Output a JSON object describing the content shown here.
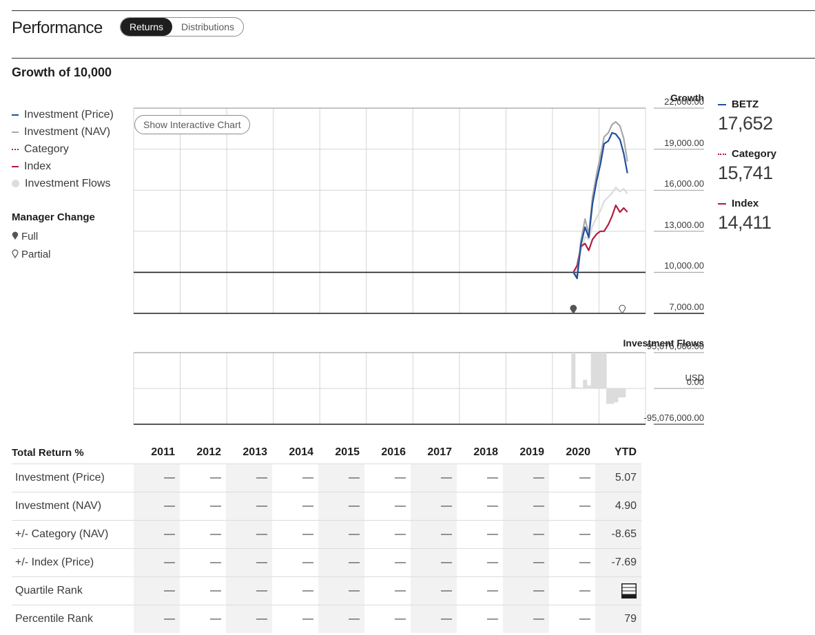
{
  "header": {
    "title": "Performance",
    "tabs": [
      "Returns",
      "Distributions"
    ]
  },
  "growth": {
    "title": "Growth of 10,000",
    "legend": [
      {
        "label": "Investment (Price)",
        "color": "#1f4e9c",
        "kind": "line"
      },
      {
        "label": "Investment (NAV)",
        "color": "#a8a8a8",
        "kind": "line"
      },
      {
        "label": "Category",
        "color": "#b01c3c",
        "kind": "dotted"
      },
      {
        "label": "Index",
        "color": "#b01c3c",
        "kind": "line"
      },
      {
        "label": "Investment Flows",
        "color": "#dddddd",
        "kind": "dot"
      }
    ],
    "manager_change": {
      "title": "Manager Change",
      "full": "Full",
      "partial": "Partial"
    },
    "button": "Show Interactive Chart",
    "summary": [
      {
        "name": "BETZ",
        "value": "17,652",
        "color": "#1f4e9c"
      },
      {
        "name": "Category",
        "value": "15,741",
        "color": "#b01c3c"
      },
      {
        "name": "Index",
        "value": "14,411",
        "color": "#b01c3c"
      }
    ]
  },
  "chart_data": [
    {
      "type": "line",
      "title": "Growth",
      "ylim": [
        7000,
        22000
      ],
      "yticks": [
        "22,000.00",
        "19,000.00",
        "16,000.00",
        "13,000.00",
        "10,000.00",
        "7,000.00"
      ],
      "ytick_values": [
        22000,
        19000,
        16000,
        13000,
        10000,
        7000
      ],
      "baseline": 10000,
      "x_years": [
        "2011",
        "2012",
        "2013",
        "2014",
        "2015",
        "2016",
        "2017",
        "2018",
        "2019",
        "2020",
        "2021"
      ],
      "series": [
        {
          "name": "Investment (Price)",
          "color": "#1f4e9c",
          "x": [
            2020.45,
            2020.53,
            2020.61,
            2020.7,
            2020.78,
            2020.86,
            2020.95,
            2021.03,
            2021.11,
            2021.2,
            2021.28,
            2021.36,
            2021.45,
            2021.53,
            2021.61
          ],
          "values": [
            10000,
            9550,
            12000,
            13300,
            12550,
            15000,
            16700,
            17900,
            19400,
            19600,
            20200,
            20100,
            19700,
            18700,
            17250
          ]
        },
        {
          "name": "Investment (NAV)",
          "color": "#a8a8a8",
          "x": [
            2020.45,
            2020.53,
            2020.61,
            2020.7,
            2020.78,
            2020.86,
            2020.95,
            2021.03,
            2021.11,
            2021.2,
            2021.28,
            2021.36,
            2021.45,
            2021.53,
            2021.61
          ],
          "values": [
            10000,
            9700,
            12300,
            13900,
            12800,
            15500,
            17200,
            18500,
            19900,
            20200,
            20800,
            21000,
            20700,
            19800,
            18100
          ]
        },
        {
          "name": "Category",
          "color": "#dadada",
          "x": [
            2020.45,
            2020.53,
            2020.61,
            2020.7,
            2020.78,
            2020.86,
            2020.95,
            2021.03,
            2021.11,
            2021.2,
            2021.28,
            2021.36,
            2021.45,
            2021.53,
            2021.61
          ],
          "values": [
            10000,
            10300,
            11500,
            12600,
            12400,
            13400,
            14000,
            14500,
            15200,
            15500,
            15800,
            16200,
            15900,
            16100,
            15741
          ]
        },
        {
          "name": "Index",
          "color": "#b01c3c",
          "x": [
            2020.45,
            2020.53,
            2020.61,
            2020.7,
            2020.78,
            2020.86,
            2020.95,
            2021.03,
            2021.11,
            2021.2,
            2021.28,
            2021.36,
            2021.45,
            2021.53,
            2021.61
          ],
          "values": [
            10000,
            10500,
            11900,
            12100,
            11600,
            12400,
            12800,
            13000,
            13000,
            13500,
            14100,
            14900,
            14400,
            14700,
            14411
          ]
        }
      ],
      "manager_changes": [
        {
          "x": 2020.45,
          "kind": "full"
        },
        {
          "x": 2021.5,
          "kind": "partial"
        }
      ]
    },
    {
      "type": "bar",
      "title": "Investment Flows",
      "unit": "USD",
      "ylim": [
        -95076000,
        95076000
      ],
      "yticks": [
        "95,076,000.00",
        "0.00",
        "-95,076,000.00"
      ],
      "ytick_values": [
        95076000,
        0,
        -95076000
      ],
      "x": [
        2020.45,
        2020.53,
        2020.62,
        2020.7,
        2020.78,
        2020.87,
        2020.95,
        2021.03,
        2021.12,
        2021.2,
        2021.28,
        2021.37,
        2021.45,
        2021.53
      ],
      "values": [
        95000000,
        3000000,
        2000000,
        23000000,
        8000000,
        95000000,
        95000000,
        95000000,
        95000000,
        -41000000,
        -41000000,
        -37000000,
        -24000000,
        -24000000
      ]
    }
  ],
  "returns": {
    "title": "Total Return %",
    "years": [
      "2011",
      "2012",
      "2013",
      "2014",
      "2015",
      "2016",
      "2017",
      "2018",
      "2019",
      "2020",
      "YTD"
    ],
    "rows": [
      {
        "label": "Investment (Price)",
        "values": [
          "—",
          "—",
          "—",
          "—",
          "—",
          "—",
          "—",
          "—",
          "—",
          "—",
          "5.07"
        ]
      },
      {
        "label": "Investment (NAV)",
        "values": [
          "—",
          "—",
          "—",
          "—",
          "—",
          "—",
          "—",
          "—",
          "—",
          "—",
          "4.90"
        ]
      },
      {
        "label": "+/- Category (NAV)",
        "values": [
          "—",
          "—",
          "—",
          "—",
          "—",
          "—",
          "—",
          "—",
          "—",
          "—",
          "-8.65"
        ]
      },
      {
        "label": "+/- Index (Price)",
        "values": [
          "—",
          "—",
          "—",
          "—",
          "—",
          "—",
          "—",
          "—",
          "—",
          "—",
          "-7.69"
        ]
      },
      {
        "label": "Quartile Rank",
        "values": [
          "—",
          "—",
          "—",
          "—",
          "—",
          "—",
          "—",
          "—",
          "—",
          "—",
          ""
        ],
        "ytd_quartile": 4
      },
      {
        "label": "Percentile Rank",
        "values": [
          "—",
          "—",
          "—",
          "—",
          "—",
          "—",
          "—",
          "—",
          "—",
          "—",
          "79"
        ]
      }
    ]
  }
}
